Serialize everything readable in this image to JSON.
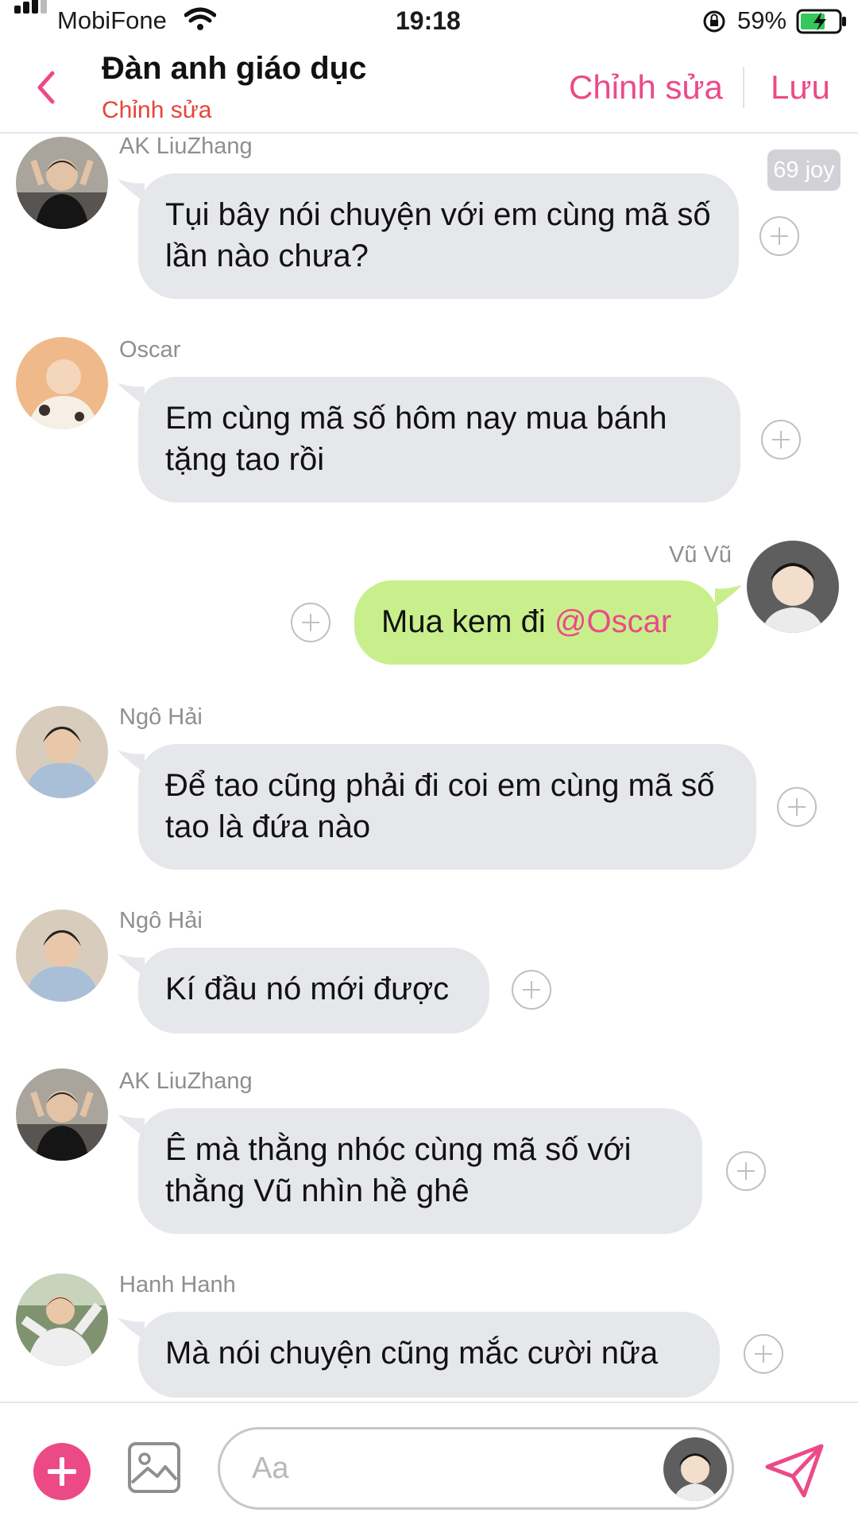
{
  "status_bar": {
    "carrier": "MobiFone",
    "time": "19:18",
    "battery": "59%"
  },
  "header": {
    "title": "Đàn anh giáo dục",
    "subtitle": "Chỉnh sửa",
    "edit_label": "Chỉnh sửa",
    "save_label": "Lưu"
  },
  "badge": "69 joy",
  "messages": [
    {
      "sender": "AK LiuZhang",
      "text": "Tụi bây nói chuyện với em cùng mã số lần nào chưa?"
    },
    {
      "sender": "Oscar",
      "text": "Em cùng mã số hôm nay mua bánh tặng tao rồi"
    },
    {
      "sender": "Vũ Vũ",
      "text": "Mua kem đi",
      "mention": "@Oscar"
    },
    {
      "sender": "Ngô Hải",
      "text": "Để tao cũng phải đi coi em cùng mã số tao là đứa nào"
    },
    {
      "sender": "Ngô Hải",
      "text": "Kí đầu nó mới được"
    },
    {
      "sender": "AK LiuZhang",
      "text": "Ê mà thằng nhóc cùng mã số với thằng Vũ nhìn hề ghê"
    },
    {
      "sender": "Hanh Hanh",
      "text": "Mà nói chuyện cũng mắc cười nữa"
    }
  ],
  "input": {
    "placeholder": "Aa"
  },
  "colors": {
    "accent": "#ec4a87",
    "subtitle": "#e8433a",
    "incoming_bubble": "#e6e7eb",
    "outgoing_bubble": "#c8ef8c",
    "plus_icon": "#bfbfc4"
  },
  "icons": [
    "signal-icon",
    "wifi-icon",
    "orientation-lock-icon",
    "battery-charging-icon",
    "back-chevron-icon",
    "add-reaction-icon",
    "add-icon",
    "image-icon",
    "send-icon"
  ]
}
